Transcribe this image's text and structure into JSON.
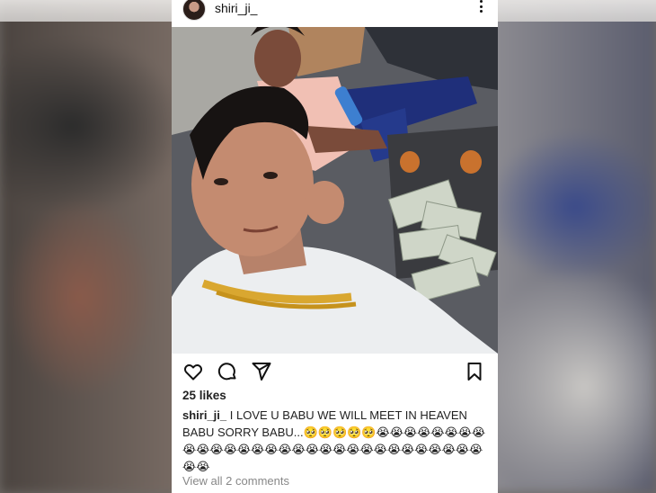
{
  "post": {
    "username": "shiri_ji_",
    "likes": "25 likes",
    "caption_user": "shiri_ji_",
    "caption_text": " I LOVE U BABU WE WILL MEET IN HEAVEN BABU SORRY BABU...🥺🥺🥺🥺🥺😭😭😭😭😭😭😭😭😭😭😭😭😭😭😭😭😭😭😭😭😭😭😭😭😭😭😭😭😭😭😭😭",
    "view_comments": "View all 2 comments"
  },
  "icons": {
    "like": "heart-icon",
    "comment": "comment-icon",
    "share": "share-icon",
    "save": "bookmark-icon",
    "more": "more-icon"
  },
  "colors": {
    "text": "#222222",
    "muted": "#888888",
    "card": "#ffffff"
  }
}
